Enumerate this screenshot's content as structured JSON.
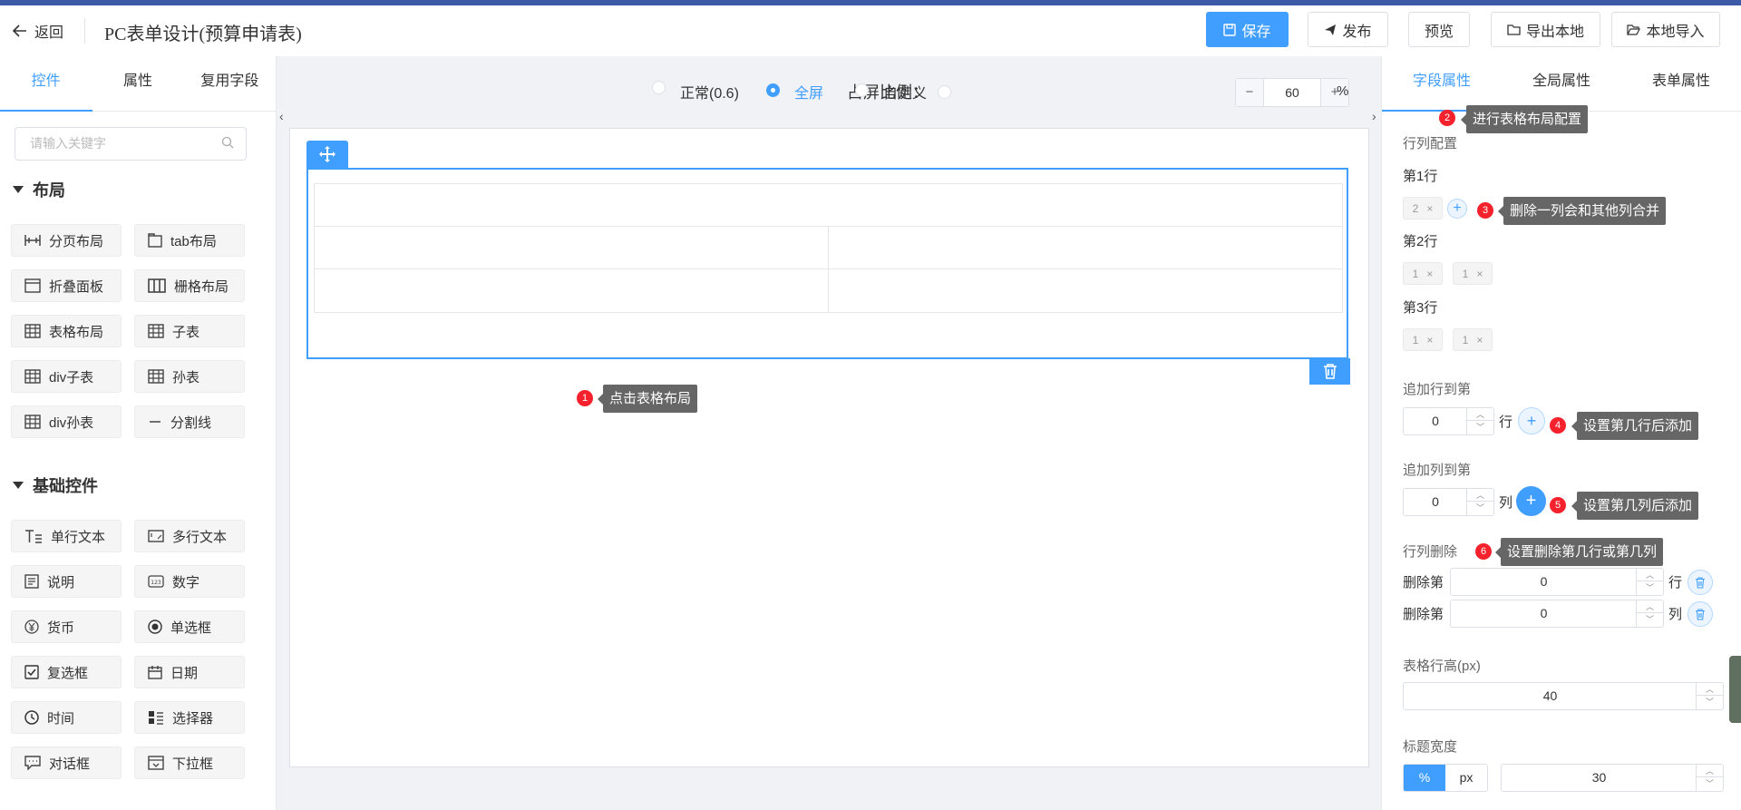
{
  "header": {
    "back_label": "返回",
    "title": "PC表单设计(预算申请表)",
    "buttons": {
      "save": "保存",
      "publish": "发布",
      "preview": "预览",
      "export": "导出本地",
      "import": "本地导入"
    }
  },
  "left": {
    "tabs": [
      "控件",
      "属性",
      "复用字段"
    ],
    "search_placeholder": "请输入关键字",
    "layout_section": "布局",
    "layout_items": [
      "分页布局",
      "tab布局",
      "折叠面板",
      "栅格布局",
      "表格布局",
      "子表",
      "div子表",
      "孙表",
      "div孙表",
      "分割线"
    ],
    "basic_section": "基础控件",
    "basic_items": [
      "单行文本",
      "多行文本",
      "说明",
      "数字",
      "货币",
      "单选框",
      "复选框",
      "日期",
      "时间",
      "选择器",
      "对话框",
      "下拉框"
    ]
  },
  "center": {
    "ratio_label": "占屏比例：",
    "options": [
      "正常(0.6)",
      "全屏",
      "自定义"
    ],
    "selected_option": "全屏",
    "zoom_value": "60",
    "zoom_unit": "%",
    "stepper_minus": "−",
    "stepper_plus": "+"
  },
  "callouts": {
    "c1": {
      "num": "1",
      "text": "点击表格布局"
    },
    "c2": {
      "num": "2",
      "text": "进行表格布局配置"
    },
    "c3": {
      "num": "3",
      "text": "删除一列会和其他列合并"
    },
    "c4": {
      "num": "4",
      "text": "设置第几行后添加"
    },
    "c5": {
      "num": "5",
      "text": "设置第几列后添加"
    },
    "c6": {
      "num": "6",
      "text": "设置删除第几行或第几列"
    }
  },
  "right": {
    "tabs": [
      "字段属性",
      "全局属性",
      "表单属性"
    ],
    "row_col_config": "行列配置",
    "row1": {
      "label": "第1行",
      "tags": [
        "2"
      ]
    },
    "row2": {
      "label": "第2行",
      "tags": [
        "1",
        "1"
      ]
    },
    "row3": {
      "label": "第3行",
      "tags": [
        "1",
        "1"
      ]
    },
    "tag_close": "×",
    "add_row_label": "追加行到第",
    "add_row_value": "0",
    "add_row_unit": "行",
    "add_col_label": "追加列到第",
    "add_col_value": "0",
    "add_col_unit": "列",
    "delete_label": "行列删除",
    "delete_prefix": "删除第",
    "delete_row_value": "0",
    "delete_row_unit": "行",
    "delete_col_value": "0",
    "delete_col_unit": "列",
    "row_height_label": "表格行高(px)",
    "row_height_value": "40",
    "title_width_label": "标题宽度",
    "title_width_units": [
      "%",
      "px"
    ],
    "title_width_value": "30"
  },
  "colors": {
    "accent": "#409eff",
    "badge": "#f5222d",
    "tooltip": "#666666"
  }
}
